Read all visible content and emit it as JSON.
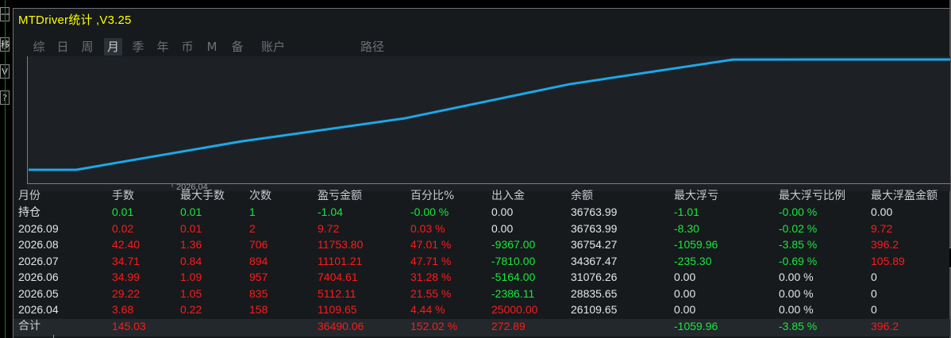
{
  "window": {
    "title": "MTDriver统计 ,V3.25"
  },
  "left_buttons": [
    "一",
    "移",
    "V",
    "?"
  ],
  "tabs": [
    {
      "label": "综",
      "active": false
    },
    {
      "label": "日",
      "active": false
    },
    {
      "label": "周",
      "active": false
    },
    {
      "label": "月",
      "active": true
    },
    {
      "label": "季",
      "active": false
    },
    {
      "label": "年",
      "active": false
    },
    {
      "label": "币",
      "active": false
    },
    {
      "label": "M",
      "active": false
    },
    {
      "label": "备",
      "active": false
    },
    {
      "label": "账户",
      "active": false
    },
    {
      "label": "路径",
      "active": false
    }
  ],
  "chart_data": {
    "type": "line",
    "x_label_visible": "2026.04",
    "series": [
      {
        "x": [
          "2026.04",
          "2026.05",
          "2026.06",
          "2026.07",
          "2026.08",
          "2026.09"
        ],
        "values": [
          26109.65,
          28835.65,
          31076.26,
          34367.47,
          36754.27,
          36763.99
        ],
        "color": "#1da8e8"
      }
    ],
    "background": "#1d2125",
    "grid": false
  },
  "table": {
    "headers": [
      "月份",
      "手数",
      "最大手数",
      "次数",
      "盈亏金额",
      "百分比%",
      "出入金",
      "余额",
      "最大浮亏",
      "最大浮亏比例",
      "最大浮盈金额"
    ],
    "rows": [
      {
        "cells": [
          "持仓",
          "0.01",
          "0.01",
          "1",
          "-1.04",
          "-0.00 %",
          "0.00",
          "36763.99",
          "-1.01",
          "-0.00 %",
          "0.00"
        ],
        "colors": [
          "wht",
          "grn",
          "grn",
          "grn",
          "grn",
          "grn",
          "wht",
          "wht",
          "grn",
          "grn",
          "wht"
        ]
      },
      {
        "cells": [
          "2026.09",
          "0.02",
          "0.01",
          "2",
          "9.72",
          "0.03 %",
          "0.00",
          "36763.99",
          "-8.30",
          "-0.02 %",
          "9.72"
        ],
        "colors": [
          "wht",
          "red",
          "red",
          "red",
          "red",
          "red",
          "wht",
          "wht",
          "grn",
          "grn",
          "red"
        ]
      },
      {
        "cells": [
          "2026.08",
          "42.40",
          "1.36",
          "706",
          "11753.80",
          "47.01 %",
          "-9367.00",
          "36754.27",
          "-1059.96",
          "-3.85 %",
          "396.2"
        ],
        "colors": [
          "wht",
          "red",
          "red",
          "red",
          "red",
          "red",
          "grn",
          "wht",
          "grn",
          "grn",
          "red"
        ]
      },
      {
        "cells": [
          "2026.07",
          "34.71",
          "0.84",
          "894",
          "11101.21",
          "47.71 %",
          "-7810.00",
          "34367.47",
          "-235.30",
          "-0.69 %",
          "105.89"
        ],
        "colors": [
          "wht",
          "red",
          "red",
          "red",
          "red",
          "red",
          "grn",
          "wht",
          "grn",
          "grn",
          "red"
        ]
      },
      {
        "cells": [
          "2026.06",
          "34.99",
          "1.09",
          "957",
          "7404.61",
          "31.28 %",
          "-5164.00",
          "31076.26",
          "0.00",
          "0.00 %",
          "0"
        ],
        "colors": [
          "wht",
          "red",
          "red",
          "red",
          "red",
          "red",
          "grn",
          "wht",
          "wht",
          "wht",
          "wht"
        ]
      },
      {
        "cells": [
          "2026.05",
          "29.22",
          "1.05",
          "835",
          "5112.11",
          "21.55 %",
          "-2386.11",
          "28835.65",
          "0.00",
          "0.00 %",
          "0"
        ],
        "colors": [
          "wht",
          "red",
          "red",
          "red",
          "red",
          "red",
          "grn",
          "wht",
          "wht",
          "wht",
          "wht"
        ]
      },
      {
        "cells": [
          "2026.04",
          "3.68",
          "0.22",
          "158",
          "1109.65",
          "4.44 %",
          "25000.00",
          "26109.65",
          "0.00",
          "0.00 %",
          "0"
        ],
        "colors": [
          "wht",
          "red",
          "red",
          "red",
          "red",
          "red",
          "red",
          "wht",
          "wht",
          "wht",
          "wht"
        ]
      }
    ],
    "total": {
      "cells": [
        "合计",
        "145.03",
        "",
        "",
        "36490.06",
        "152.02 %",
        "272.89",
        "",
        "-1059.96",
        "-3.85 %",
        "396.2"
      ],
      "colors": [
        "hdr",
        "red",
        "red",
        "red",
        "red",
        "red",
        "red",
        "wht",
        "grn",
        "grn",
        "red"
      ]
    }
  }
}
